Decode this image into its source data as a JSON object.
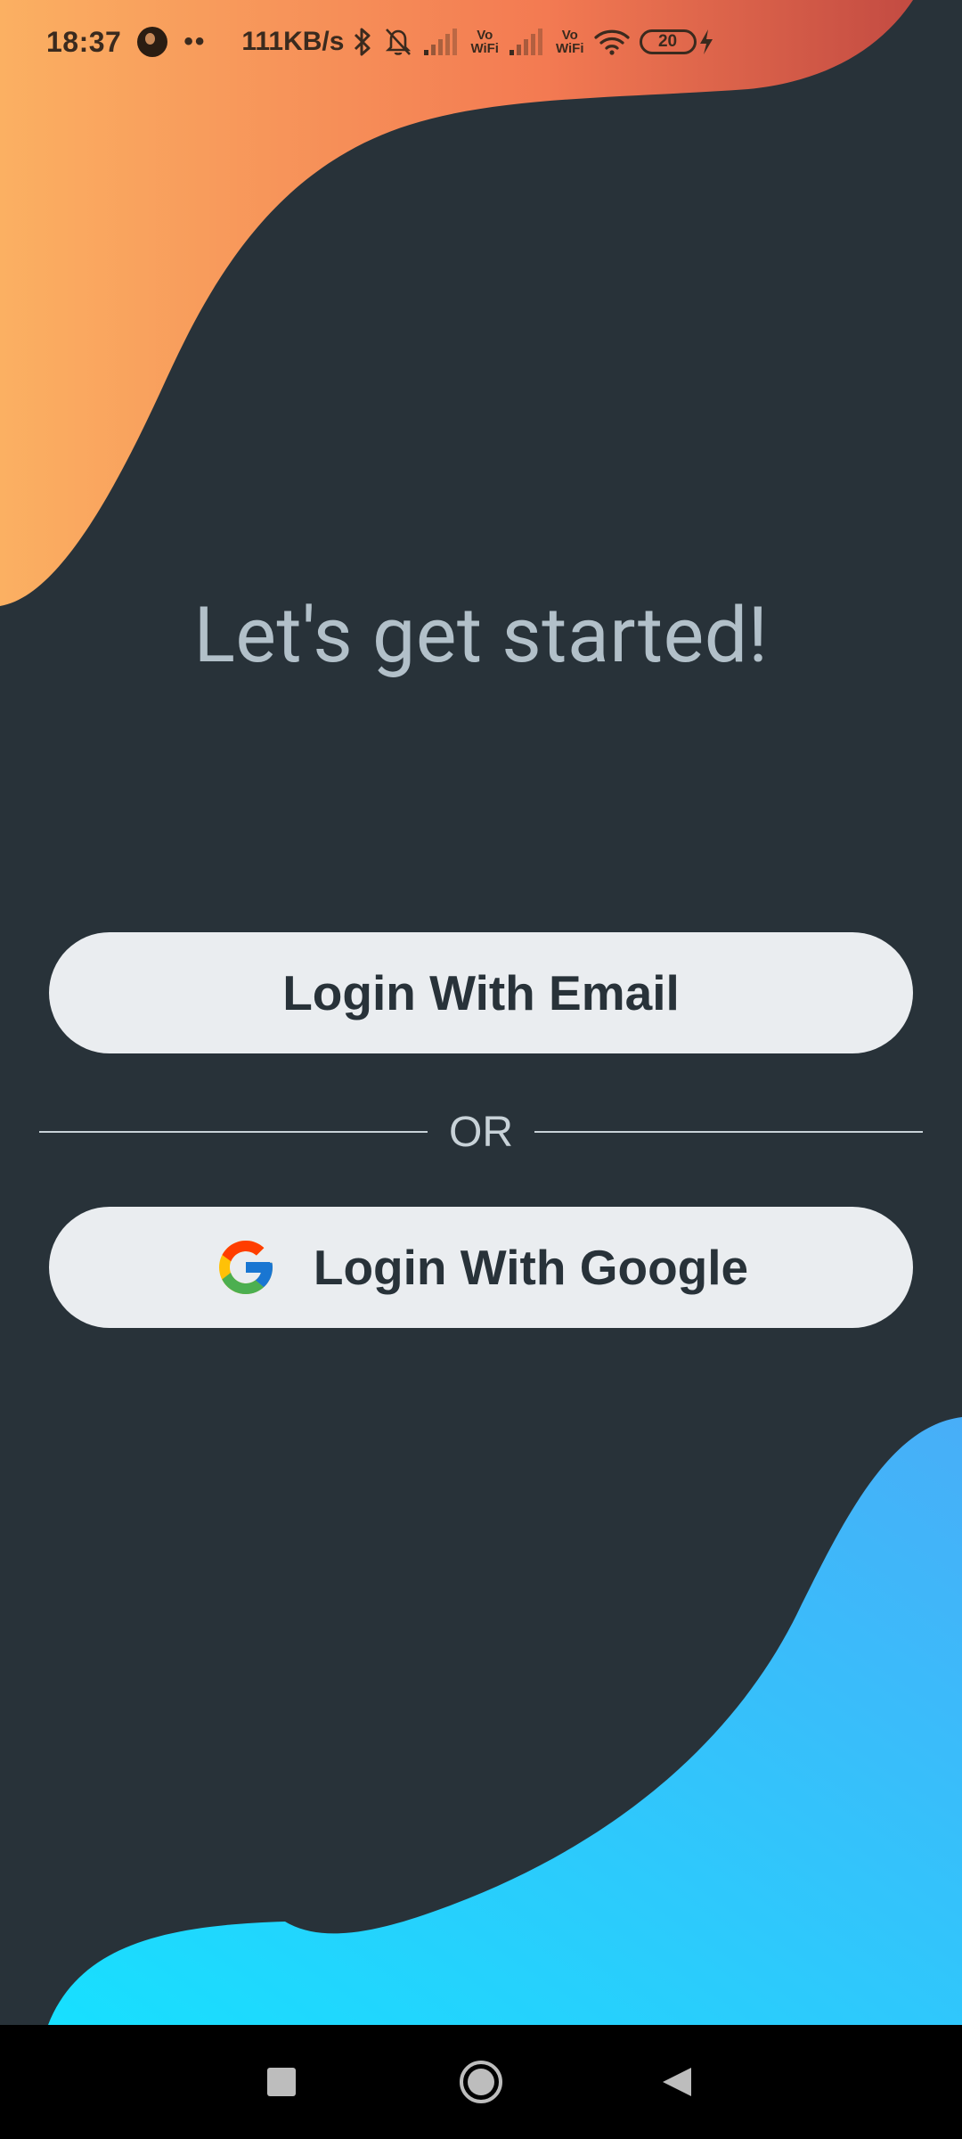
{
  "status_bar": {
    "time": "18:37",
    "dots": "••",
    "speed": "111KB/s",
    "vowifi_label_top": "Vo",
    "vowifi_label_bottom": "WiFi",
    "battery": "20"
  },
  "main": {
    "headline": "Let's get started!",
    "email_button_label": "Login With Email",
    "divider_label": "OR",
    "google_button_label": "Login With Google"
  },
  "colors": {
    "background": "#283239",
    "top_blob_gradient": [
      "#fbb062",
      "#f37a52"
    ],
    "bottom_blob_gradient": [
      "#17e0ff",
      "#48aef8"
    ],
    "button_background": "#eaedf0",
    "headline_text": "#b2c0c9"
  },
  "icons": {
    "status": [
      "app-notification-icon",
      "bluetooth-icon",
      "silent-bell-icon",
      "signal-icon",
      "wifi-icon",
      "battery-icon",
      "charging-icon"
    ],
    "buttons": [
      "google-logo-icon"
    ],
    "navigation": [
      "recents-square-icon",
      "home-circle-icon",
      "back-triangle-icon"
    ]
  }
}
